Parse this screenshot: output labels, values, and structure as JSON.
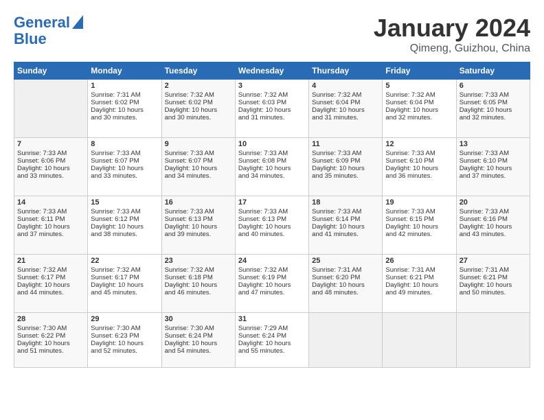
{
  "header": {
    "logo_line1": "General",
    "logo_line2": "Blue",
    "month": "January 2024",
    "location": "Qimeng, Guizhou, China"
  },
  "days_of_week": [
    "Sunday",
    "Monday",
    "Tuesday",
    "Wednesday",
    "Thursday",
    "Friday",
    "Saturday"
  ],
  "weeks": [
    [
      {
        "day": "",
        "info": ""
      },
      {
        "day": "1",
        "info": "Sunrise: 7:31 AM\nSunset: 6:02 PM\nDaylight: 10 hours\nand 30 minutes."
      },
      {
        "day": "2",
        "info": "Sunrise: 7:32 AM\nSunset: 6:02 PM\nDaylight: 10 hours\nand 30 minutes."
      },
      {
        "day": "3",
        "info": "Sunrise: 7:32 AM\nSunset: 6:03 PM\nDaylight: 10 hours\nand 31 minutes."
      },
      {
        "day": "4",
        "info": "Sunrise: 7:32 AM\nSunset: 6:04 PM\nDaylight: 10 hours\nand 31 minutes."
      },
      {
        "day": "5",
        "info": "Sunrise: 7:32 AM\nSunset: 6:04 PM\nDaylight: 10 hours\nand 32 minutes."
      },
      {
        "day": "6",
        "info": "Sunrise: 7:33 AM\nSunset: 6:05 PM\nDaylight: 10 hours\nand 32 minutes."
      }
    ],
    [
      {
        "day": "7",
        "info": "Sunrise: 7:33 AM\nSunset: 6:06 PM\nDaylight: 10 hours\nand 33 minutes."
      },
      {
        "day": "8",
        "info": "Sunrise: 7:33 AM\nSunset: 6:07 PM\nDaylight: 10 hours\nand 33 minutes."
      },
      {
        "day": "9",
        "info": "Sunrise: 7:33 AM\nSunset: 6:07 PM\nDaylight: 10 hours\nand 34 minutes."
      },
      {
        "day": "10",
        "info": "Sunrise: 7:33 AM\nSunset: 6:08 PM\nDaylight: 10 hours\nand 34 minutes."
      },
      {
        "day": "11",
        "info": "Sunrise: 7:33 AM\nSunset: 6:09 PM\nDaylight: 10 hours\nand 35 minutes."
      },
      {
        "day": "12",
        "info": "Sunrise: 7:33 AM\nSunset: 6:10 PM\nDaylight: 10 hours\nand 36 minutes."
      },
      {
        "day": "13",
        "info": "Sunrise: 7:33 AM\nSunset: 6:10 PM\nDaylight: 10 hours\nand 37 minutes."
      }
    ],
    [
      {
        "day": "14",
        "info": "Sunrise: 7:33 AM\nSunset: 6:11 PM\nDaylight: 10 hours\nand 37 minutes."
      },
      {
        "day": "15",
        "info": "Sunrise: 7:33 AM\nSunset: 6:12 PM\nDaylight: 10 hours\nand 38 minutes."
      },
      {
        "day": "16",
        "info": "Sunrise: 7:33 AM\nSunset: 6:13 PM\nDaylight: 10 hours\nand 39 minutes."
      },
      {
        "day": "17",
        "info": "Sunrise: 7:33 AM\nSunset: 6:13 PM\nDaylight: 10 hours\nand 40 minutes."
      },
      {
        "day": "18",
        "info": "Sunrise: 7:33 AM\nSunset: 6:14 PM\nDaylight: 10 hours\nand 41 minutes."
      },
      {
        "day": "19",
        "info": "Sunrise: 7:33 AM\nSunset: 6:15 PM\nDaylight: 10 hours\nand 42 minutes."
      },
      {
        "day": "20",
        "info": "Sunrise: 7:33 AM\nSunset: 6:16 PM\nDaylight: 10 hours\nand 43 minutes."
      }
    ],
    [
      {
        "day": "21",
        "info": "Sunrise: 7:32 AM\nSunset: 6:17 PM\nDaylight: 10 hours\nand 44 minutes."
      },
      {
        "day": "22",
        "info": "Sunrise: 7:32 AM\nSunset: 6:17 PM\nDaylight: 10 hours\nand 45 minutes."
      },
      {
        "day": "23",
        "info": "Sunrise: 7:32 AM\nSunset: 6:18 PM\nDaylight: 10 hours\nand 46 minutes."
      },
      {
        "day": "24",
        "info": "Sunrise: 7:32 AM\nSunset: 6:19 PM\nDaylight: 10 hours\nand 47 minutes."
      },
      {
        "day": "25",
        "info": "Sunrise: 7:31 AM\nSunset: 6:20 PM\nDaylight: 10 hours\nand 48 minutes."
      },
      {
        "day": "26",
        "info": "Sunrise: 7:31 AM\nSunset: 6:21 PM\nDaylight: 10 hours\nand 49 minutes."
      },
      {
        "day": "27",
        "info": "Sunrise: 7:31 AM\nSunset: 6:21 PM\nDaylight: 10 hours\nand 50 minutes."
      }
    ],
    [
      {
        "day": "28",
        "info": "Sunrise: 7:30 AM\nSunset: 6:22 PM\nDaylight: 10 hours\nand 51 minutes."
      },
      {
        "day": "29",
        "info": "Sunrise: 7:30 AM\nSunset: 6:23 PM\nDaylight: 10 hours\nand 52 minutes."
      },
      {
        "day": "30",
        "info": "Sunrise: 7:30 AM\nSunset: 6:24 PM\nDaylight: 10 hours\nand 54 minutes."
      },
      {
        "day": "31",
        "info": "Sunrise: 7:29 AM\nSunset: 6:24 PM\nDaylight: 10 hours\nand 55 minutes."
      },
      {
        "day": "",
        "info": ""
      },
      {
        "day": "",
        "info": ""
      },
      {
        "day": "",
        "info": ""
      }
    ]
  ]
}
